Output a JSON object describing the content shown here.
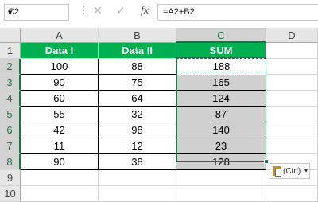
{
  "formula_bar": {
    "name_box": "C2",
    "name_box_dropdown": "▾",
    "more_glyph": "⋮",
    "cancel_glyph": "✕",
    "enter_glyph": "✓",
    "fx_label": "fx",
    "formula": "=A2+B2"
  },
  "columns": [
    "A",
    "B",
    "C",
    "D"
  ],
  "rows": [
    "1",
    "2",
    "3",
    "4",
    "5",
    "6",
    "7",
    "8",
    "9",
    "10"
  ],
  "table": {
    "headers": [
      "Data I",
      "Data II",
      "SUM"
    ],
    "rows": [
      [
        "100",
        "88",
        "188"
      ],
      [
        "90",
        "75",
        "165"
      ],
      [
        "60",
        "64",
        "124"
      ],
      [
        "55",
        "32",
        "87"
      ],
      [
        "42",
        "98",
        "140"
      ],
      [
        "11",
        "12",
        "23"
      ],
      [
        "90",
        "38",
        "128"
      ]
    ]
  },
  "paste_options": {
    "label": "(Ctrl)",
    "arrow": "▾"
  },
  "colors": {
    "header_fill": "#00b050",
    "selection": "#217346",
    "selected_fill": "#d0d0d0"
  }
}
